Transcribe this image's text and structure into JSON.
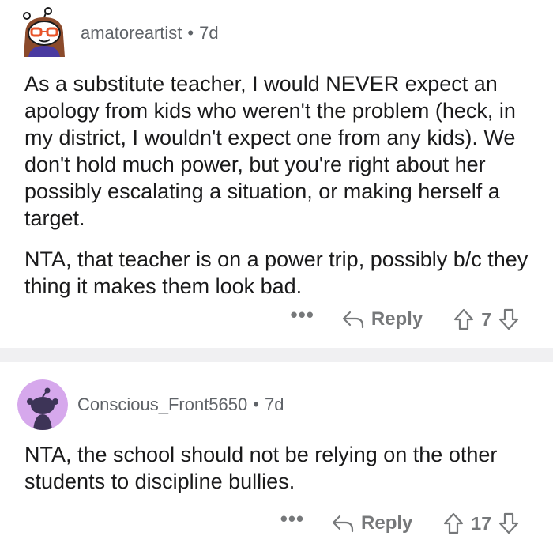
{
  "comments": [
    {
      "username": "amatoreartist",
      "age": "7d",
      "paragraphs": [
        "As a substitute teacher, I would NEVER expect an apology from kids who weren't the problem (heck, in my district, I wouldn't expect one from any kids). We don't hold much power, but you're right about her possibly escalating a situation, or making herself a target.",
        "NTA, that teacher is on a power trip, possibly b/c they thing it makes them look bad."
      ],
      "more": "•••",
      "reply_label": "Reply",
      "score": "7"
    },
    {
      "username": "Conscious_Front5650",
      "age": "7d",
      "paragraphs": [
        "NTA, the school should not be relying on the other students to discipline bullies."
      ],
      "more": "•••",
      "reply_label": "Reply",
      "score": "17"
    }
  ],
  "separator": "•",
  "colors": {
    "text": "#1a1a1b",
    "meta": "#5f6368",
    "action": "#76787a",
    "divider": "#f0f0f2",
    "avatar2_bg": "#d6a8ec"
  },
  "icons": [
    "reply-arrow-icon",
    "upvote-icon",
    "downvote-icon",
    "more-icon"
  ]
}
